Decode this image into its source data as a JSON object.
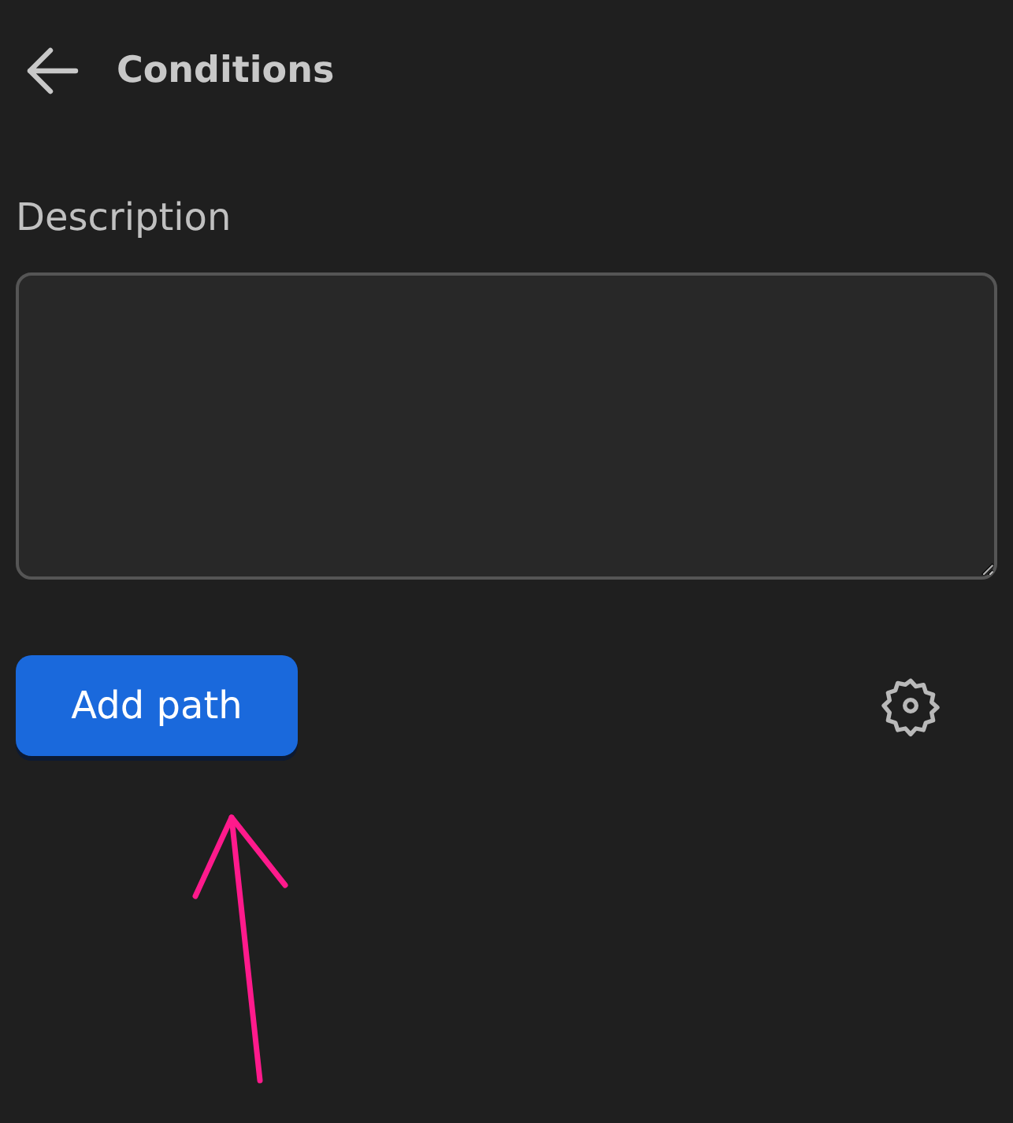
{
  "header": {
    "title": "Conditions"
  },
  "description": {
    "label": "Description"
  },
  "actions": {
    "primary_button": "Add path"
  }
}
